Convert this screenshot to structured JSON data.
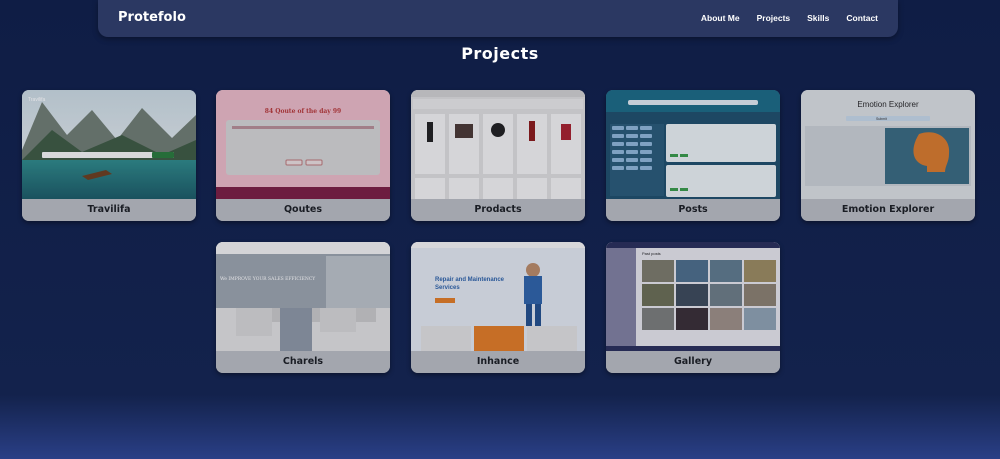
{
  "nav": {
    "brand": "Protefolo",
    "links": [
      "About Me",
      "Projects",
      "Skills",
      "Contact"
    ]
  },
  "projects_section": {
    "title": "Projects",
    "cards": [
      {
        "label": "Travilifa"
      },
      {
        "label": "Qoutes"
      },
      {
        "label": "Prodacts"
      },
      {
        "label": "Posts"
      },
      {
        "label": "Emotion Explorer"
      },
      {
        "label": "Charels"
      },
      {
        "label": "Inhance"
      },
      {
        "label": "Gallery"
      }
    ]
  },
  "thumbnails": {
    "travilifa": {
      "brand": "Travilifa"
    },
    "qoutes": {
      "heading": "84 Qoute of the day 99"
    },
    "emotion": {
      "title": "Emotion Explorer",
      "button": "Submit"
    },
    "charels": {
      "heading": "We IMPROVE YOUR SALES EFFICIENCY"
    },
    "inhance": {
      "heading": "Repair and Maintenance Services"
    },
    "gallery": {
      "heading": "Past posts"
    }
  },
  "colors": {
    "navbar": "#2b3862",
    "page_background": "#13224c",
    "card": "#9fa2aa"
  }
}
